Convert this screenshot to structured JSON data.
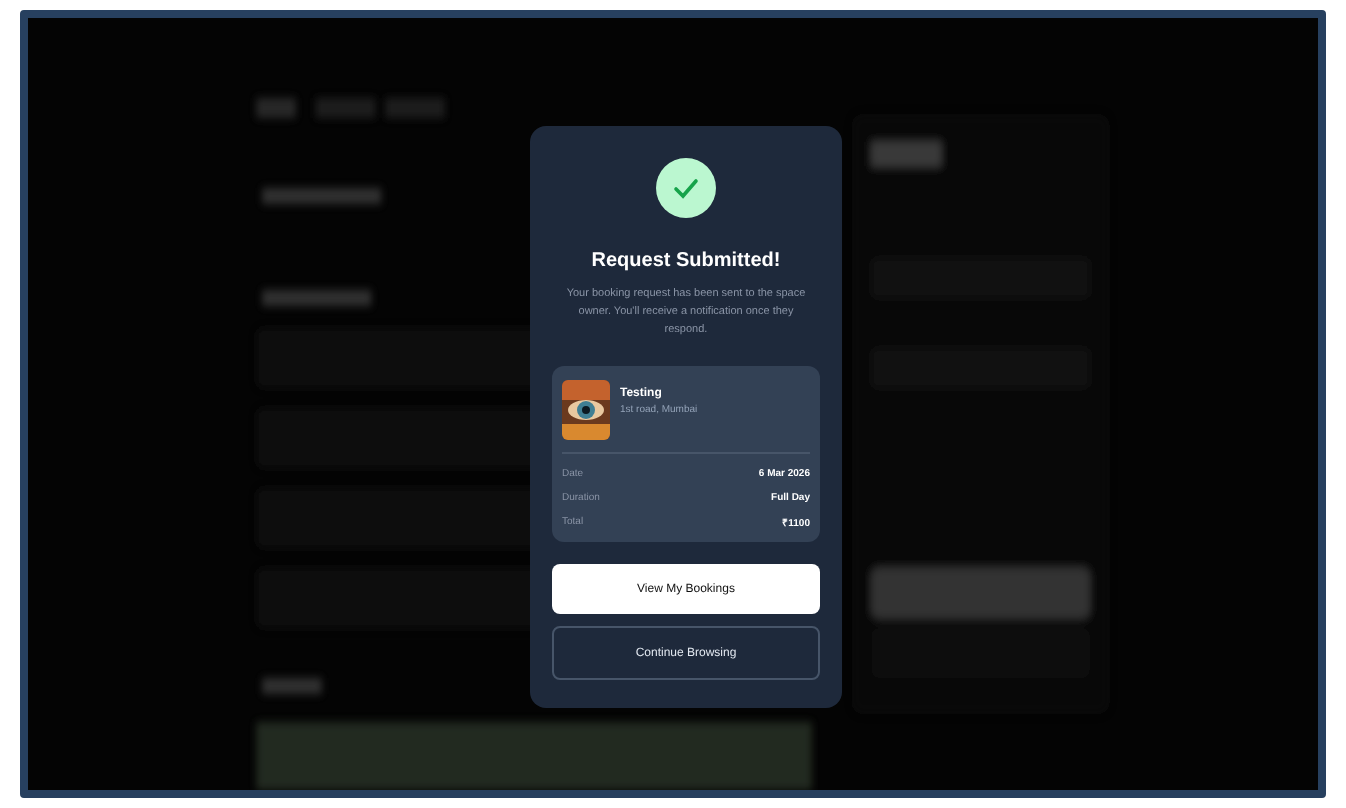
{
  "dialog": {
    "title": "Request Submitted!",
    "message": "Your booking request has been sent to the space owner. You'll receive a notification once they respond.",
    "booking": {
      "name": "Testing",
      "location": "1st road, Mumbai",
      "kind": "picture",
      "details": [
        {
          "label": "Date",
          "value": "6 Mar 2026"
        },
        {
          "label": "Duration",
          "value": "Full Day"
        },
        {
          "label": "Total",
          "value": "₹1100"
        }
      ]
    },
    "buttons": [
      {
        "label": "View My Bookings",
        "kind": "primary"
      },
      {
        "label": "Continue Browsing",
        "kind": "outline"
      }
    ]
  }
}
